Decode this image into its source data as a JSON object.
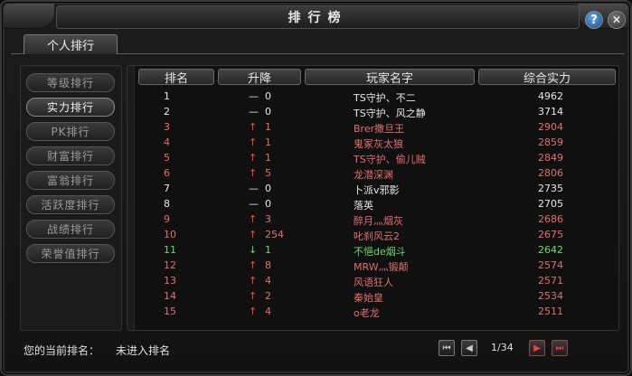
{
  "window": {
    "title": "排行榜"
  },
  "tabs": [
    {
      "label": "个人排行"
    }
  ],
  "sidebar": {
    "items": [
      {
        "label": "等级排行",
        "active": false
      },
      {
        "label": "实力排行",
        "active": true
      },
      {
        "label": "PK排行",
        "active": false
      },
      {
        "label": "财富排行",
        "active": false
      },
      {
        "label": "富翁排行",
        "active": false
      },
      {
        "label": "活跃度排行",
        "active": false
      },
      {
        "label": "战绩排行",
        "active": false
      },
      {
        "label": "荣誉值排行",
        "active": false
      }
    ]
  },
  "table": {
    "columns": [
      "排名",
      "升降",
      "玩家名字",
      "综合实力"
    ],
    "rows": [
      {
        "rank": "1",
        "arrow": "—",
        "delta": "0",
        "name": "TS守护、不二",
        "power": "4962",
        "color": "#e8e8e8",
        "arrow_color": "#e8e8e8"
      },
      {
        "rank": "2",
        "arrow": "—",
        "delta": "0",
        "name": "TS守护、风之静",
        "power": "3714",
        "color": "#e8e8e8",
        "arrow_color": "#e8e8e8"
      },
      {
        "rank": "3",
        "arrow": "↑",
        "delta": "1",
        "name": "Brer撒旦王",
        "power": "2904",
        "color": "#e07070",
        "arrow_color": "#ff4a4a"
      },
      {
        "rank": "4",
        "arrow": "↑",
        "delta": "1",
        "name": "鬼冢灰太狼",
        "power": "2859",
        "color": "#e07070",
        "arrow_color": "#ff4a4a"
      },
      {
        "rank": "5",
        "arrow": "↑",
        "delta": "1",
        "name": "TS守护、偷儿贼",
        "power": "2849",
        "color": "#e07070",
        "arrow_color": "#ff4a4a"
      },
      {
        "rank": "6",
        "arrow": "↑",
        "delta": "5",
        "name": "龙潜深渊",
        "power": "2806",
        "color": "#e07070",
        "arrow_color": "#ff4a4a"
      },
      {
        "rank": "7",
        "arrow": "—",
        "delta": "0",
        "name": "卜派v邪影",
        "power": "2735",
        "color": "#e8e8e8",
        "arrow_color": "#e8e8e8"
      },
      {
        "rank": "8",
        "arrow": "—",
        "delta": "0",
        "name": "落英",
        "power": "2705",
        "color": "#e8e8e8",
        "arrow_color": "#e8e8e8"
      },
      {
        "rank": "9",
        "arrow": "↑",
        "delta": "3",
        "name": "醉月灬烟灰",
        "power": "2686",
        "color": "#e07070",
        "arrow_color": "#ff4a4a"
      },
      {
        "rank": "10",
        "arrow": "↑",
        "delta": "254",
        "name": "叱刹风云2",
        "power": "2675",
        "color": "#e07070",
        "arrow_color": "#ff4a4a"
      },
      {
        "rank": "11",
        "arrow": "↓",
        "delta": "1",
        "name": "不悒de烟斗",
        "power": "2642",
        "color": "#6ed86e",
        "arrow_color": "#6ed86e"
      },
      {
        "rank": "12",
        "arrow": "↑",
        "delta": "8",
        "name": "MRW灬锻颠",
        "power": "2574",
        "color": "#e07070",
        "arrow_color": "#ff4a4a"
      },
      {
        "rank": "13",
        "arrow": "↑",
        "delta": "4",
        "name": "风语狂人",
        "power": "2571",
        "color": "#e07070",
        "arrow_color": "#ff4a4a"
      },
      {
        "rank": "14",
        "arrow": "↑",
        "delta": "2",
        "name": "秦始皇",
        "power": "2534",
        "color": "#e07070",
        "arrow_color": "#ff4a4a"
      },
      {
        "rank": "15",
        "arrow": "↑",
        "delta": "4",
        "name": "o老龙",
        "power": "2511",
        "color": "#e07070",
        "arrow_color": "#ff4a4a"
      }
    ]
  },
  "footer": {
    "current_rank_label": "您的当前排名：",
    "current_rank_value": "未进入排名",
    "page_text": "1/34",
    "icons": {
      "first": "first-page-icon",
      "prev": "prev-page-icon",
      "next": "next-page-icon",
      "last": "last-page-icon"
    }
  },
  "buttons": {
    "help_glyph": "?",
    "close_glyph": "✕"
  }
}
